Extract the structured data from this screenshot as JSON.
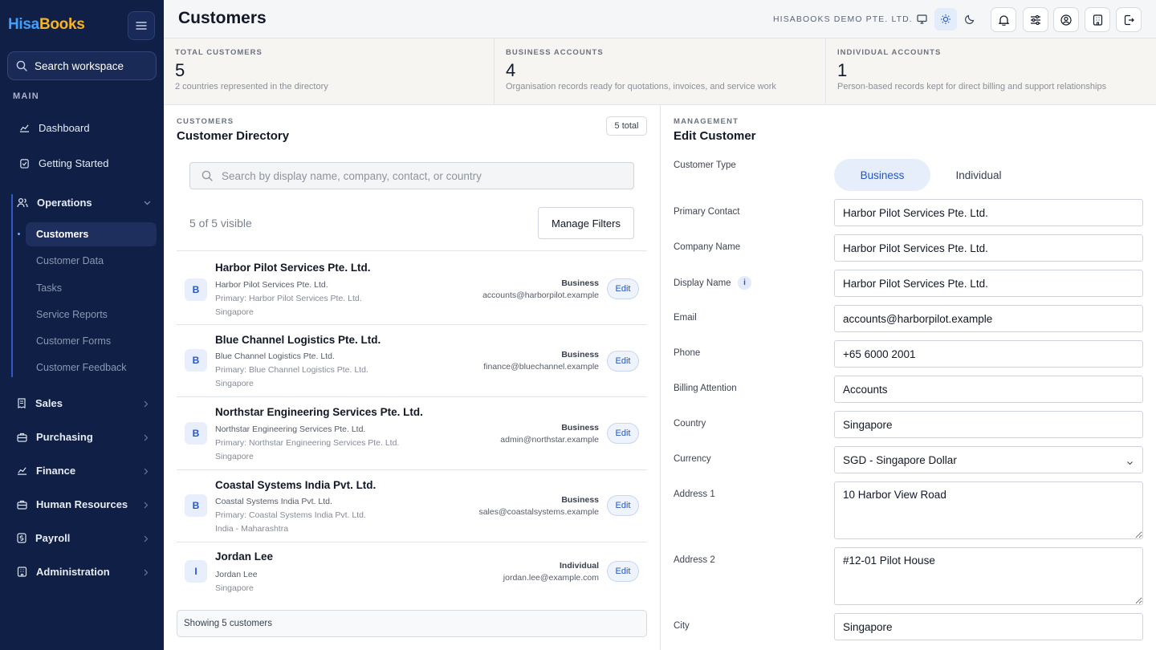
{
  "sidebar": {
    "logo_a": "Hisa",
    "logo_b": "Books",
    "search_label": "Search workspace",
    "main_label": "MAIN",
    "items": {
      "dashboard": "Dashboard",
      "getting_started": "Getting Started",
      "operations": "Operations",
      "sales": "Sales",
      "purchasing": "Purchasing",
      "finance": "Finance",
      "human_resources": "Human Resources",
      "payroll": "Payroll",
      "administration": "Administration"
    },
    "operations_sub": [
      "Customers",
      "Customer Data",
      "Tasks",
      "Service Reports",
      "Customer Forms",
      "Customer Feedback"
    ]
  },
  "header": {
    "title": "Customers",
    "company": "HISABOOKS DEMO PTE. LTD."
  },
  "stats": [
    {
      "label": "TOTAL CUSTOMERS",
      "value": "5",
      "desc": "2 countries represented in the directory"
    },
    {
      "label": "BUSINESS ACCOUNTS",
      "value": "4",
      "desc": "Organisation records ready for quotations, invoices, and service work"
    },
    {
      "label": "INDIVIDUAL ACCOUNTS",
      "value": "1",
      "desc": "Person-based records kept for direct billing and support relationships"
    }
  ],
  "directory": {
    "section_label": "CUSTOMERS",
    "title": "Customer Directory",
    "total_badge": "5 total",
    "search_placeholder": "Search by display name, company, contact, or country",
    "visible_count": "5 of 5 visible",
    "manage_filters": "Manage Filters",
    "edit_label": "Edit",
    "footer": "Showing 5 customers",
    "customers": [
      {
        "initial": "B",
        "name": "Harbor Pilot Services Pte. Ltd.",
        "company": "Harbor Pilot Services Pte. Ltd.",
        "primary": "Primary: Harbor Pilot Services Pte. Ltd.",
        "location": "Singapore",
        "type": "Business",
        "email": "accounts@harborpilot.example"
      },
      {
        "initial": "B",
        "name": "Blue Channel Logistics Pte. Ltd.",
        "company": "Blue Channel Logistics Pte. Ltd.",
        "primary": "Primary: Blue Channel Logistics Pte. Ltd.",
        "location": "Singapore",
        "type": "Business",
        "email": "finance@bluechannel.example"
      },
      {
        "initial": "B",
        "name": "Northstar Engineering Services Pte. Ltd.",
        "company": "Northstar Engineering Services Pte. Ltd.",
        "primary": "Primary: Northstar Engineering Services Pte. Ltd.",
        "location": "Singapore",
        "type": "Business",
        "email": "admin@northstar.example"
      },
      {
        "initial": "B",
        "name": "Coastal Systems India Pvt. Ltd.",
        "company": "Coastal Systems India Pvt. Ltd.",
        "primary": "Primary: Coastal Systems India Pvt. Ltd.",
        "location": "India - Maharashtra",
        "type": "Business",
        "email": "sales@coastalsystems.example"
      },
      {
        "initial": "I",
        "name": "Jordan Lee",
        "company": "Jordan Lee",
        "primary": "",
        "location": "Singapore",
        "type": "Individual",
        "email": "jordan.lee@example.com"
      }
    ]
  },
  "edit": {
    "section_label": "MANAGEMENT",
    "title": "Edit Customer",
    "type_label": "Customer Type",
    "type_business": "Business",
    "type_individual": "Individual",
    "fields": {
      "primary_contact": {
        "label": "Primary Contact",
        "value": "Harbor Pilot Services Pte. Ltd."
      },
      "company_name": {
        "label": "Company Name",
        "value": "Harbor Pilot Services Pte. Ltd."
      },
      "display_name": {
        "label": "Display Name",
        "value": "Harbor Pilot Services Pte. Ltd."
      },
      "email": {
        "label": "Email",
        "value": "accounts@harborpilot.example"
      },
      "phone": {
        "label": "Phone",
        "value": "+65 6000 2001"
      },
      "billing_attention": {
        "label": "Billing Attention",
        "value": "Accounts"
      },
      "country": {
        "label": "Country",
        "value": "Singapore"
      },
      "currency": {
        "label": "Currency",
        "value": "SGD - Singapore Dollar"
      },
      "address1": {
        "label": "Address 1",
        "value": "10 Harbor View Road"
      },
      "address2": {
        "label": "Address 2",
        "value": "#12-01 Pilot House"
      },
      "city": {
        "label": "City",
        "value": "Singapore"
      }
    },
    "info_glyph": "i"
  },
  "colors": {
    "sidebar": "#0f1f45",
    "accent": "#2457c5",
    "logo_a": "#3fa0ff",
    "logo_b": "#f5b32a"
  }
}
